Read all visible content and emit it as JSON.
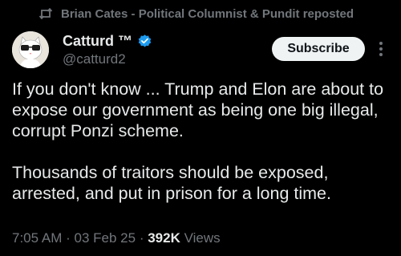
{
  "repost": {
    "text": "Brian Cates - Political Columnist & Pundit reposted",
    "icon": "repost-icon"
  },
  "author": {
    "display_name": "Catturd ™",
    "handle": "@catturd2",
    "verified_icon": "verified-badge-icon",
    "verified_color": "#1d9bf0",
    "avatar_icon": "cat-avatar"
  },
  "actions": {
    "subscribe_label": "Subscribe",
    "more_icon": "more-vertical-icon"
  },
  "tweet": {
    "paragraph_1": "If you don't know  ... Trump and Elon are about to expose our government as being one big illegal, corrupt Ponzi scheme.",
    "paragraph_2": "Thousands of traitors should be exposed, arrested, and put in prison for a long time."
  },
  "meta": {
    "time": "7:05 AM",
    "separator": "·",
    "date": "03 Feb 25",
    "views_count": "392K",
    "views_label": "Views"
  },
  "colors": {
    "background": "#000000",
    "text_primary": "#e7e9ea",
    "text_secondary": "#71767b",
    "button_bg": "#eff3f4",
    "button_text": "#0f1419"
  }
}
